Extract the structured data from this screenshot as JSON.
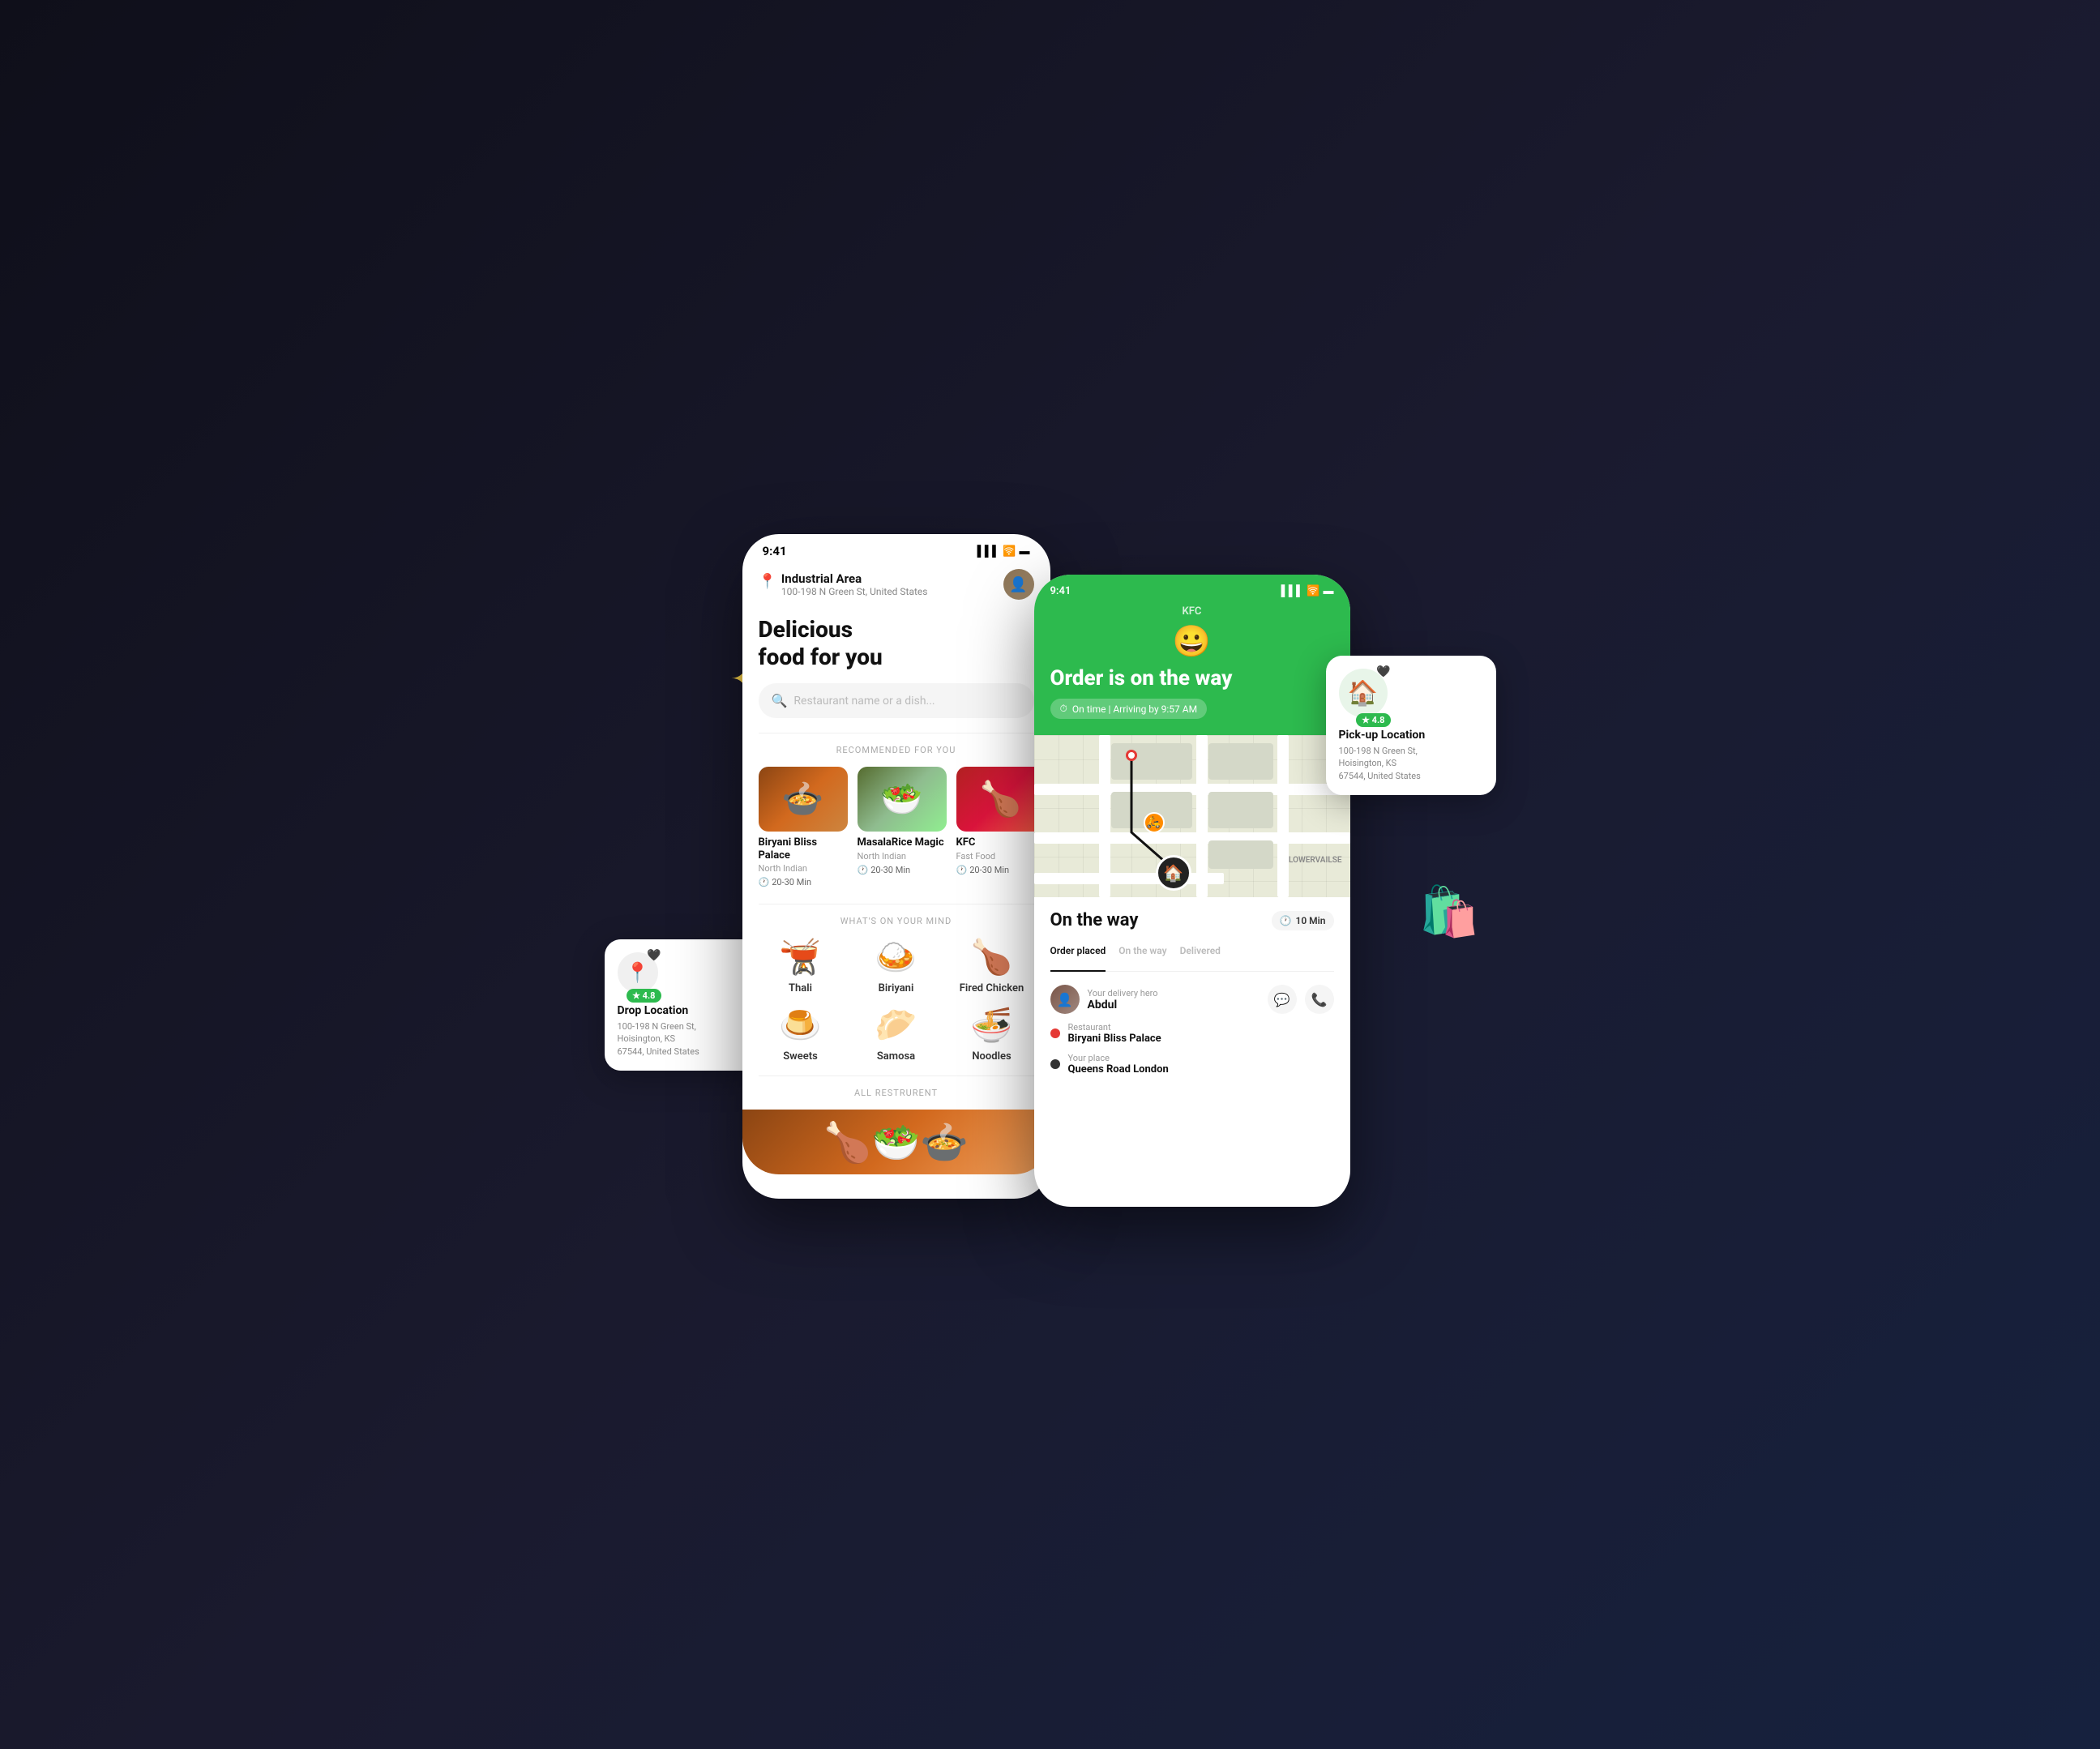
{
  "scene": {
    "decorative": {
      "sparkle": "✦",
      "sparkle2": "✦"
    }
  },
  "phone1": {
    "statusBar": {
      "time": "9:41",
      "signal": "▌▌▌",
      "wifi": "WiFi",
      "battery": "🔋"
    },
    "header": {
      "locationName": "Industrial Area",
      "locationAddress": "100-198 N Green St, United States",
      "avatarEmoji": "👤"
    },
    "hero": {
      "line1": "Delicious",
      "line2": "food for you"
    },
    "search": {
      "placeholder": "Restaurant name or a dish..."
    },
    "sections": {
      "recommended": "RECOMMENDED FOR YOU",
      "whatsOnMind": "WHAT'S ON YOUR MIND",
      "allRestaurants": "ALL RESTRURENT"
    },
    "restaurants": [
      {
        "name": "Biryani Bliss Palace",
        "cuisine": "North Indian",
        "time": "20-30 Min",
        "emoji": "🍲"
      },
      {
        "name": "MasalaRice Magic",
        "cuisine": "North Indian",
        "time": "20-30 Min",
        "emoji": "🥗"
      },
      {
        "name": "KFC",
        "cuisine": "Fast Food",
        "time": "20-30 Min",
        "emoji": "🍗"
      }
    ],
    "categories": [
      {
        "name": "Thali",
        "emoji": "🫕"
      },
      {
        "name": "Biriyani",
        "emoji": "🍛"
      },
      {
        "name": "Fired Chicken",
        "emoji": "🍗"
      },
      {
        "name": "Sweets",
        "emoji": "🍮"
      },
      {
        "name": "Samosa",
        "emoji": "🥟"
      },
      {
        "name": "Noodles",
        "emoji": "🍜"
      }
    ]
  },
  "phone2": {
    "statusBar": {
      "time": "9:41"
    },
    "brand": "KFC",
    "emoji": "😀",
    "orderTitle": "Order is on the way",
    "onTimeBadge": "⏱ On time  |  Arriving by 9:57 AM",
    "tracking": {
      "title": "On the way",
      "timeBadge": "🕐 10 Min",
      "steps": [
        {
          "label": "Order placed",
          "active": true
        },
        {
          "label": "On the way",
          "active": false
        },
        {
          "label": "Delivered",
          "active": false
        }
      ]
    },
    "delivery": {
      "heroLabel": "Your delivery hero",
      "heroName": "Abdul",
      "restaurantLabel": "Restaurant",
      "restaurantName": "Biryani Bliss Palace",
      "placeLabel": "Your place",
      "placeName": "Queens Road London"
    },
    "map": {
      "label": "LOWERVAILSE"
    }
  },
  "sideCardLeft": {
    "type": "Drop Location",
    "address": "100-198 N Green St,\nHoisington, KS\n67544, United States",
    "rating": "★ 4.8",
    "emoji": "📍"
  },
  "sideCardRight": {
    "type": "Pick-up Location",
    "address": "100-198 N Green St,\nHoisington, KS\n67544, United States",
    "rating": "★ 4.8",
    "emoji": "🏠"
  },
  "colors": {
    "green": "#2dba4e",
    "red": "#e53935",
    "dark": "#111111",
    "gray": "#888888"
  }
}
